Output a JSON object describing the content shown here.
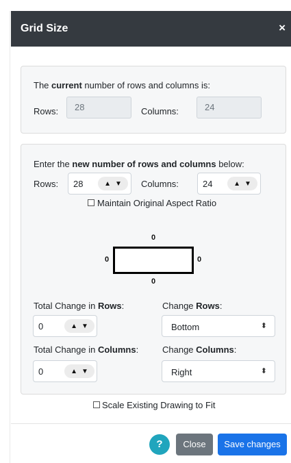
{
  "modal": {
    "title": "Grid Size",
    "close_glyph": "×"
  },
  "current": {
    "intro_prefix": "The ",
    "intro_bold": "current",
    "intro_suffix": " number of rows and columns is:",
    "rows_label": "Rows:",
    "rows_value": "28",
    "columns_label": "Columns:",
    "columns_value": "24"
  },
  "new_size": {
    "intro_prefix": "Enter the ",
    "intro_bold": "new number of rows and columns",
    "intro_suffix": " below:",
    "rows_label": "Rows:",
    "rows_value": "28",
    "columns_label": "Columns:",
    "columns_value": "24",
    "maintain_aspect_label": "Maintain Original Aspect Ratio",
    "maintain_aspect_checked": false
  },
  "diagram": {
    "top": "0",
    "left": "0",
    "right": "0",
    "bottom": "0"
  },
  "changes": {
    "total_rows_prefix": "Total Change in ",
    "total_rows_bold": "Rows",
    "total_rows_suffix": ":",
    "total_rows_value": "0",
    "change_rows_prefix": "Change ",
    "change_rows_bold": "Rows",
    "change_rows_suffix": ":",
    "change_rows_selected": "Bottom",
    "total_cols_prefix": "Total Change in ",
    "total_cols_bold": "Columns",
    "total_cols_suffix": ":",
    "total_cols_value": "0",
    "change_cols_prefix": "Change ",
    "change_cols_bold": "Columns",
    "change_cols_suffix": ":",
    "change_cols_selected": "Right"
  },
  "scale_label": "Scale Existing Drawing to Fit",
  "scale_checked": false,
  "footer": {
    "help_label": "?",
    "close_label": "Close",
    "save_label": "Save changes"
  },
  "colors": {
    "header_bg": "#353a40",
    "help": "#20a5bd",
    "close": "#6c757d",
    "save": "#1a73e8"
  },
  "icons": {
    "spin": "up-down-arrows-icon",
    "select": "sort-caret-icon"
  }
}
